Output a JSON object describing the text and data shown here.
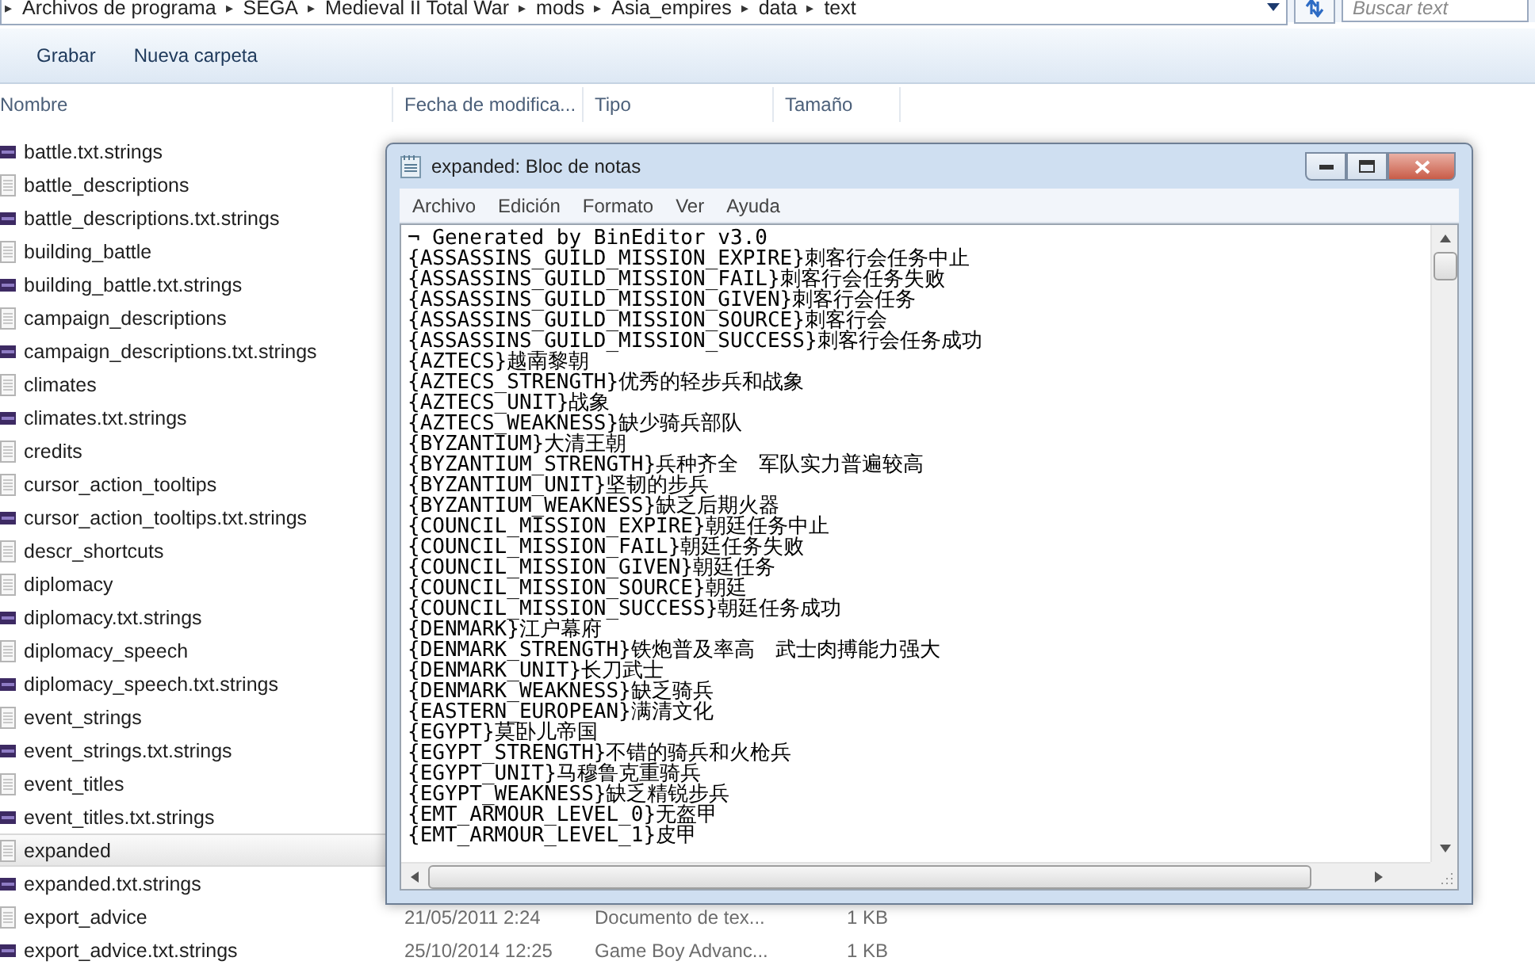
{
  "address_bar": {
    "crumbs": [
      "Archivos de programa",
      "SEGA",
      "Medieval II Total War",
      "mods",
      "Asia_empires",
      "data",
      "text"
    ],
    "separator": "▸"
  },
  "search": {
    "placeholder": "Buscar text"
  },
  "toolbar": {
    "buttons": [
      "Grabar",
      "Nueva carpeta"
    ]
  },
  "columns": [
    "Nombre",
    "Fecha de modifica...",
    "Tipo",
    "Tamaño"
  ],
  "files": [
    {
      "name": "battle.txt.strings",
      "kind": "strings",
      "selected": false
    },
    {
      "name": "battle_descriptions",
      "kind": "text",
      "selected": false
    },
    {
      "name": "battle_descriptions.txt.strings",
      "kind": "strings",
      "selected": false
    },
    {
      "name": "building_battle",
      "kind": "text",
      "selected": false
    },
    {
      "name": "building_battle.txt.strings",
      "kind": "strings",
      "selected": false
    },
    {
      "name": "campaign_descriptions",
      "kind": "text",
      "selected": false
    },
    {
      "name": "campaign_descriptions.txt.strings",
      "kind": "strings",
      "selected": false
    },
    {
      "name": "climates",
      "kind": "text",
      "selected": false
    },
    {
      "name": "climates.txt.strings",
      "kind": "strings",
      "selected": false
    },
    {
      "name": "credits",
      "kind": "text",
      "selected": false
    },
    {
      "name": "cursor_action_tooltips",
      "kind": "text",
      "selected": false
    },
    {
      "name": "cursor_action_tooltips.txt.strings",
      "kind": "strings",
      "selected": false
    },
    {
      "name": "descr_shortcuts",
      "kind": "text",
      "selected": false
    },
    {
      "name": "diplomacy",
      "kind": "text",
      "selected": false
    },
    {
      "name": "diplomacy.txt.strings",
      "kind": "strings",
      "selected": false
    },
    {
      "name": "diplomacy_speech",
      "kind": "text",
      "selected": false
    },
    {
      "name": "diplomacy_speech.txt.strings",
      "kind": "strings",
      "selected": false
    },
    {
      "name": "event_strings",
      "kind": "text",
      "selected": false
    },
    {
      "name": "event_strings.txt.strings",
      "kind": "strings",
      "selected": false
    },
    {
      "name": "event_titles",
      "kind": "text",
      "selected": false
    },
    {
      "name": "event_titles.txt.strings",
      "kind": "strings",
      "selected": false
    },
    {
      "name": "expanded",
      "kind": "text",
      "selected": true
    },
    {
      "name": "expanded.txt.strings",
      "kind": "strings",
      "selected": false
    },
    {
      "name": "export_advice",
      "kind": "text",
      "selected": false,
      "date": "21/05/2011 2:24",
      "type": "Documento de tex...",
      "size": "1 KB"
    },
    {
      "name": "export_advice.txt.strings",
      "kind": "strings",
      "selected": false,
      "date": "25/10/2014 12:25",
      "type": "Game Boy Advanc...",
      "size": "1 KB"
    }
  ],
  "notepad": {
    "title": "expanded: Bloc de notas",
    "menu": [
      "Archivo",
      "Edición",
      "Formato",
      "Ver",
      "Ayuda"
    ],
    "lines": [
      "¬ Generated by BinEditor v3.0",
      "{ASSASSINS_GUILD_MISSION_EXPIRE}刺客行会任务中止",
      "{ASSASSINS_GUILD_MISSION_FAIL}刺客行会任务失败",
      "{ASSASSINS_GUILD_MISSION_GIVEN}刺客行会任务",
      "{ASSASSINS_GUILD_MISSION_SOURCE}刺客行会",
      "{ASSASSINS_GUILD_MISSION_SUCCESS}刺客行会任务成功",
      "{AZTECS}越南黎朝",
      "{AZTECS_STRENGTH}优秀的轻步兵和战象",
      "{AZTECS_UNIT}战象",
      "{AZTECS_WEAKNESS}缺少骑兵部队",
      "{BYZANTIUM}大清王朝",
      "{BYZANTIUM_STRENGTH}兵种齐全　军队实力普遍较高",
      "{BYZANTIUM_UNIT}坚韧的步兵",
      "{BYZANTIUM_WEAKNESS}缺乏后期火器",
      "{COUNCIL_MISSION_EXPIRE}朝廷任务中止",
      "{COUNCIL_MISSION_FAIL}朝廷任务失败",
      "{COUNCIL_MISSION_GIVEN}朝廷任务",
      "{COUNCIL_MISSION_SOURCE}朝廷",
      "{COUNCIL_MISSION_SUCCESS}朝廷任务成功",
      "{DENMARK}江户幕府",
      "{DENMARK_STRENGTH}铁炮普及率高　武士肉搏能力强大",
      "{DENMARK_UNIT}长刀武士",
      "{DENMARK_WEAKNESS}缺乏骑兵",
      "{EASTERN_EUROPEAN}满清文化",
      "{EGYPT}莫卧儿帝国",
      "{EGYPT_STRENGTH}不错的骑兵和火枪兵",
      "{EGYPT_UNIT}马穆鲁克重骑兵",
      "{EGYPT_WEAKNESS}缺乏精锐步兵",
      "{EMT_ARMOUR_LEVEL_0}无盔甲",
      "{EMT_ARMOUR_LEVEL_1}皮甲"
    ]
  }
}
